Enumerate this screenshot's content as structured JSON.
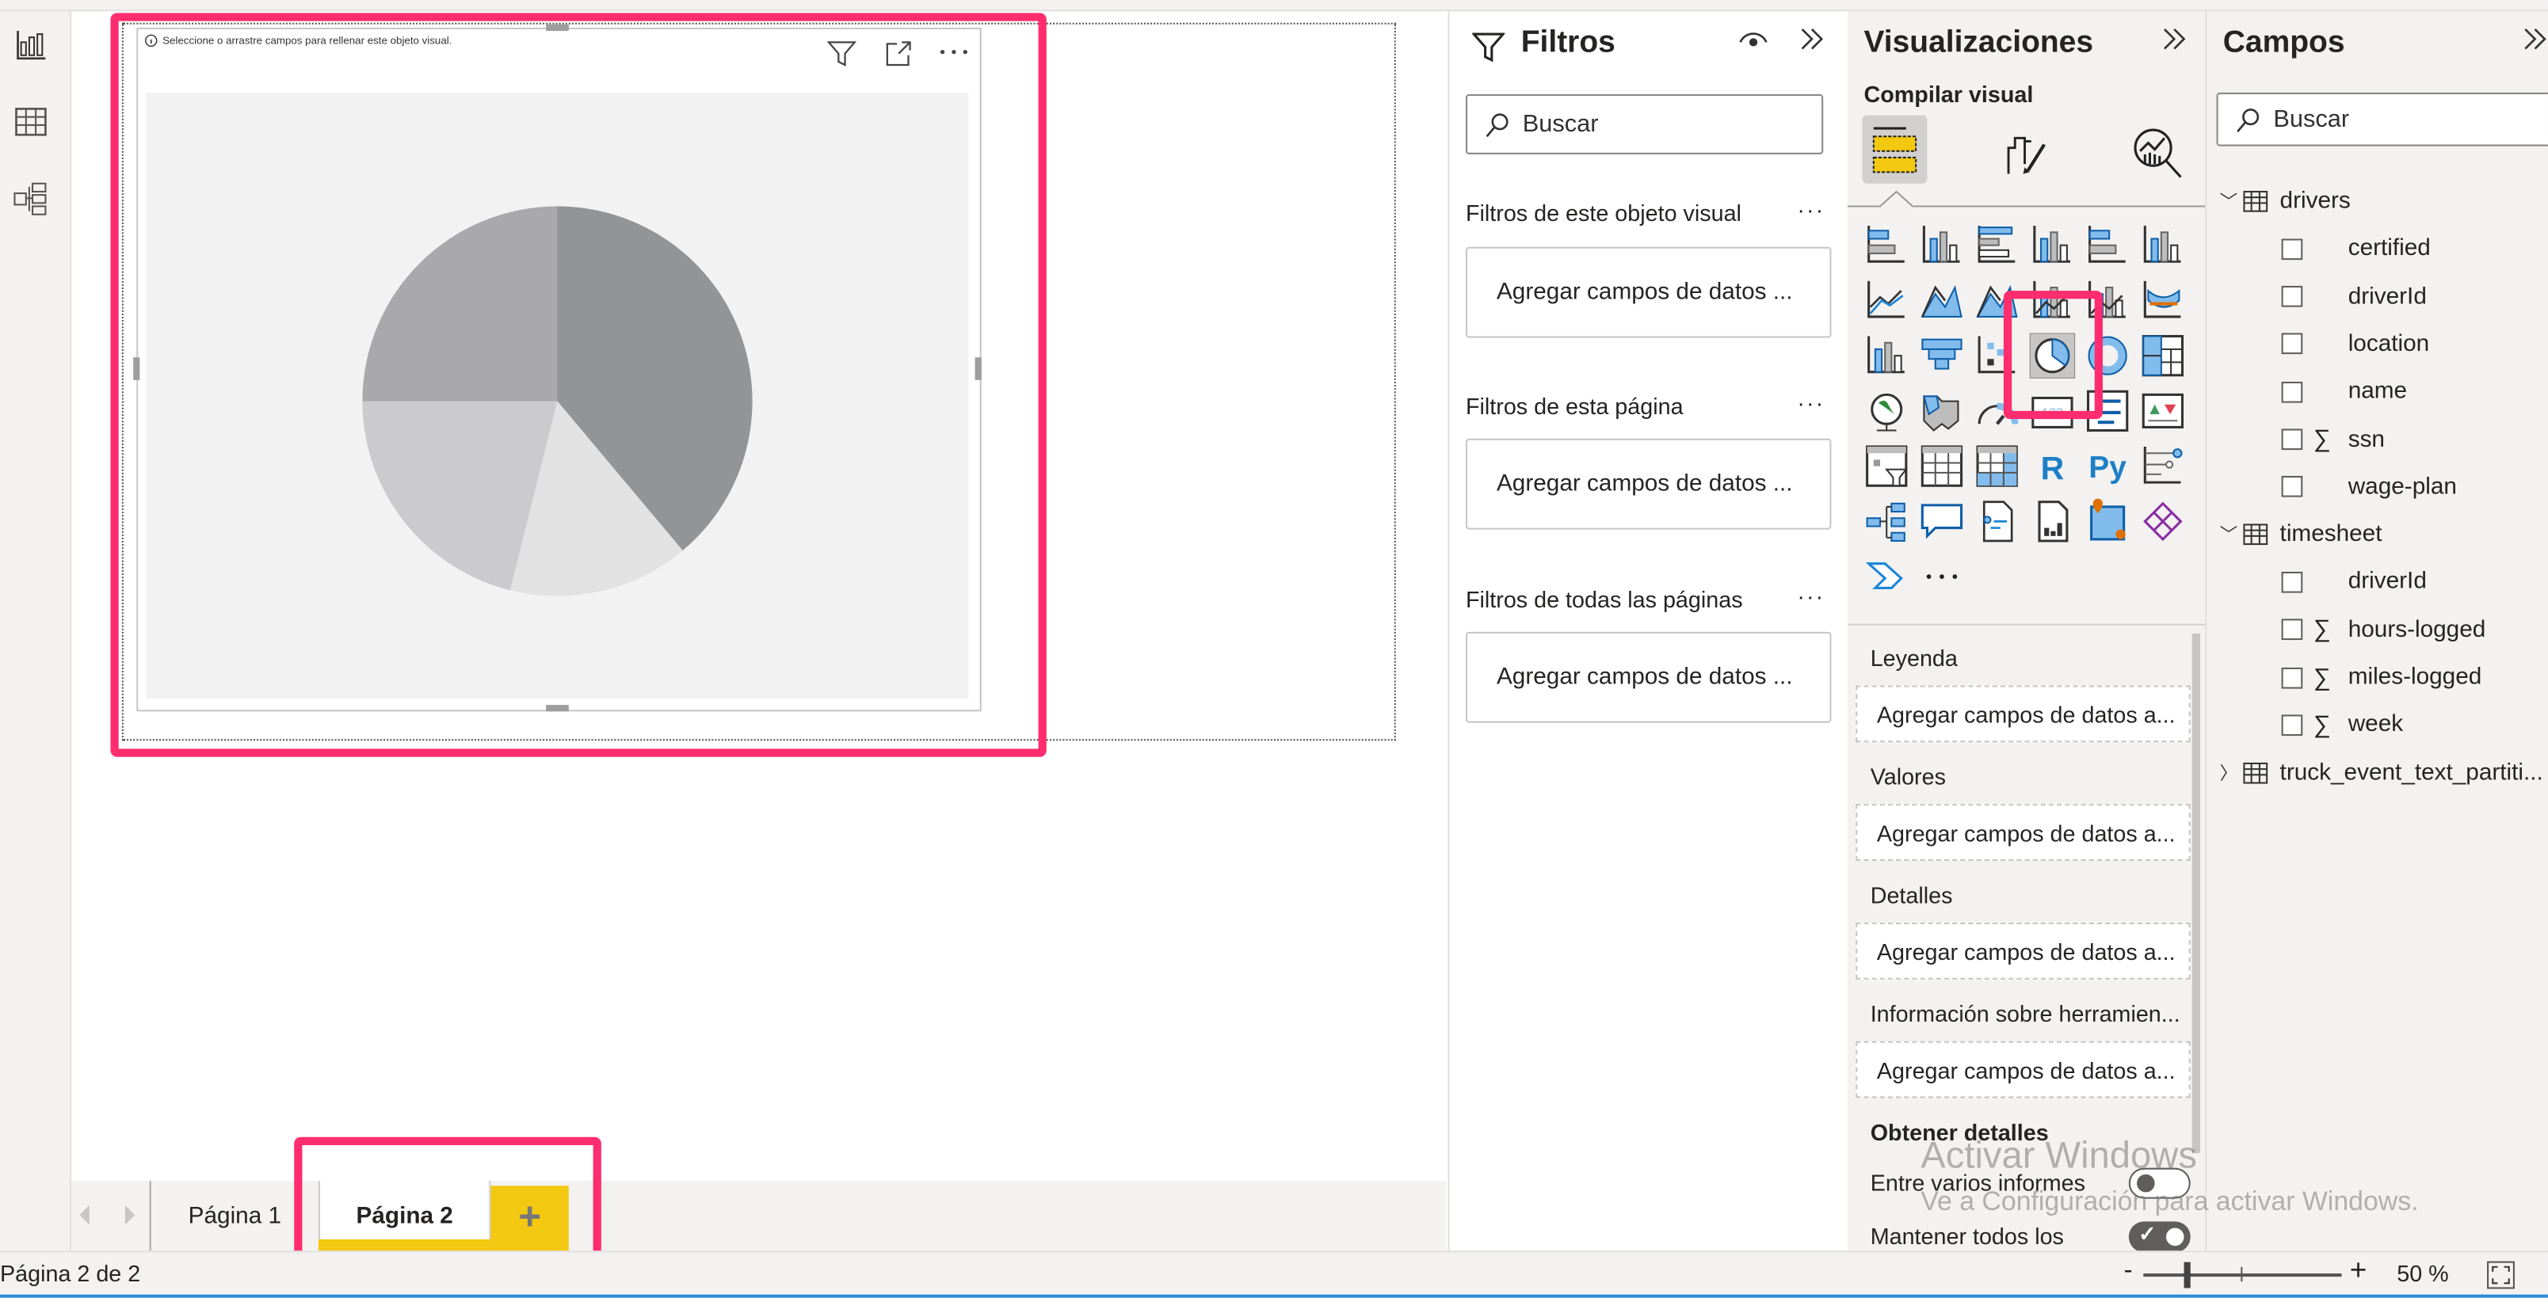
{
  "visual": {
    "hint": "Seleccione o arrastre campos para rellenar este objeto visual.",
    "header_icons": [
      "filter-icon",
      "focus-mode-icon",
      "more-options-icon"
    ]
  },
  "pages": {
    "tabs": [
      {
        "label": "Página 1",
        "active": false
      },
      {
        "label": "Página 2",
        "active": true
      }
    ],
    "add_label": "+",
    "status": "Página 2 de 2"
  },
  "filters": {
    "title": "Filtros",
    "search_placeholder": "Buscar",
    "sections": [
      {
        "label": "Filtros de este objeto visual",
        "drop": "Agregar campos de datos ..."
      },
      {
        "label": "Filtros de esta página",
        "drop": "Agregar campos de datos ..."
      },
      {
        "label": "Filtros de todas las páginas",
        "drop": "Agregar campos de datos ..."
      }
    ]
  },
  "visualizations": {
    "title": "Visualizaciones",
    "build_label": "Compilar visual",
    "selected": "pie-chart",
    "icons": [
      "stacked-bar",
      "stacked-column",
      "clustered-bar",
      "clustered-column",
      "100-stacked-bar",
      "100-stacked-column",
      "line",
      "area",
      "stacked-area",
      "line-column",
      "line-clustered-column",
      "ribbon",
      "waterfall",
      "funnel",
      "scatter",
      "pie-chart",
      "donut",
      "treemap",
      "map",
      "filled-map",
      "gauge",
      "card",
      "multi-row-card",
      "kpi",
      "slicer",
      "table",
      "matrix",
      "r-visual",
      "python-visual",
      "key-influencers",
      "decomposition-tree",
      "qna",
      "smart-narrative",
      "paginated-report",
      "arcgis-map",
      "power-apps",
      "power-automate",
      "more"
    ],
    "wells": [
      {
        "label": "Leyenda",
        "drop": "Agregar campos de datos a..."
      },
      {
        "label": "Valores",
        "drop": "Agregar campos de datos a..."
      },
      {
        "label": "Detalles",
        "drop": "Agregar campos de datos a..."
      },
      {
        "label": "Información sobre herramien...",
        "drop": "Agregar campos de datos a..."
      }
    ],
    "drillthrough": {
      "title": "Obtener detalles",
      "cross_report": {
        "label": "Entre varios informes",
        "on": false
      },
      "keep_filters": {
        "label": "Mantener todos los",
        "on": true
      }
    }
  },
  "fields": {
    "title": "Campos",
    "search_placeholder": "Buscar",
    "tables": [
      {
        "name": "drivers",
        "expanded": true,
        "fields": [
          {
            "name": "certified",
            "sum": false
          },
          {
            "name": "driverId",
            "sum": false
          },
          {
            "name": "location",
            "sum": false
          },
          {
            "name": "name",
            "sum": false
          },
          {
            "name": "ssn",
            "sum": true
          },
          {
            "name": "wage-plan",
            "sum": false
          }
        ]
      },
      {
        "name": "timesheet",
        "expanded": true,
        "fields": [
          {
            "name": "driverId",
            "sum": false
          },
          {
            "name": "hours-logged",
            "sum": true
          },
          {
            "name": "miles-logged",
            "sum": true
          },
          {
            "name": "week",
            "sum": true
          }
        ]
      },
      {
        "name": "truck_event_text_partiti...",
        "expanded": false,
        "fields": []
      }
    ]
  },
  "zoom": {
    "label": "50 %",
    "level": 50,
    "minus": "-",
    "plus": "+"
  },
  "watermark": {
    "line1": "Activar Windows",
    "line2": "Ve a Configuración para activar Windows."
  },
  "colors": {
    "highlight": "#ff2d6f",
    "accent": "#f2c811",
    "blue": "#2b88d8"
  }
}
